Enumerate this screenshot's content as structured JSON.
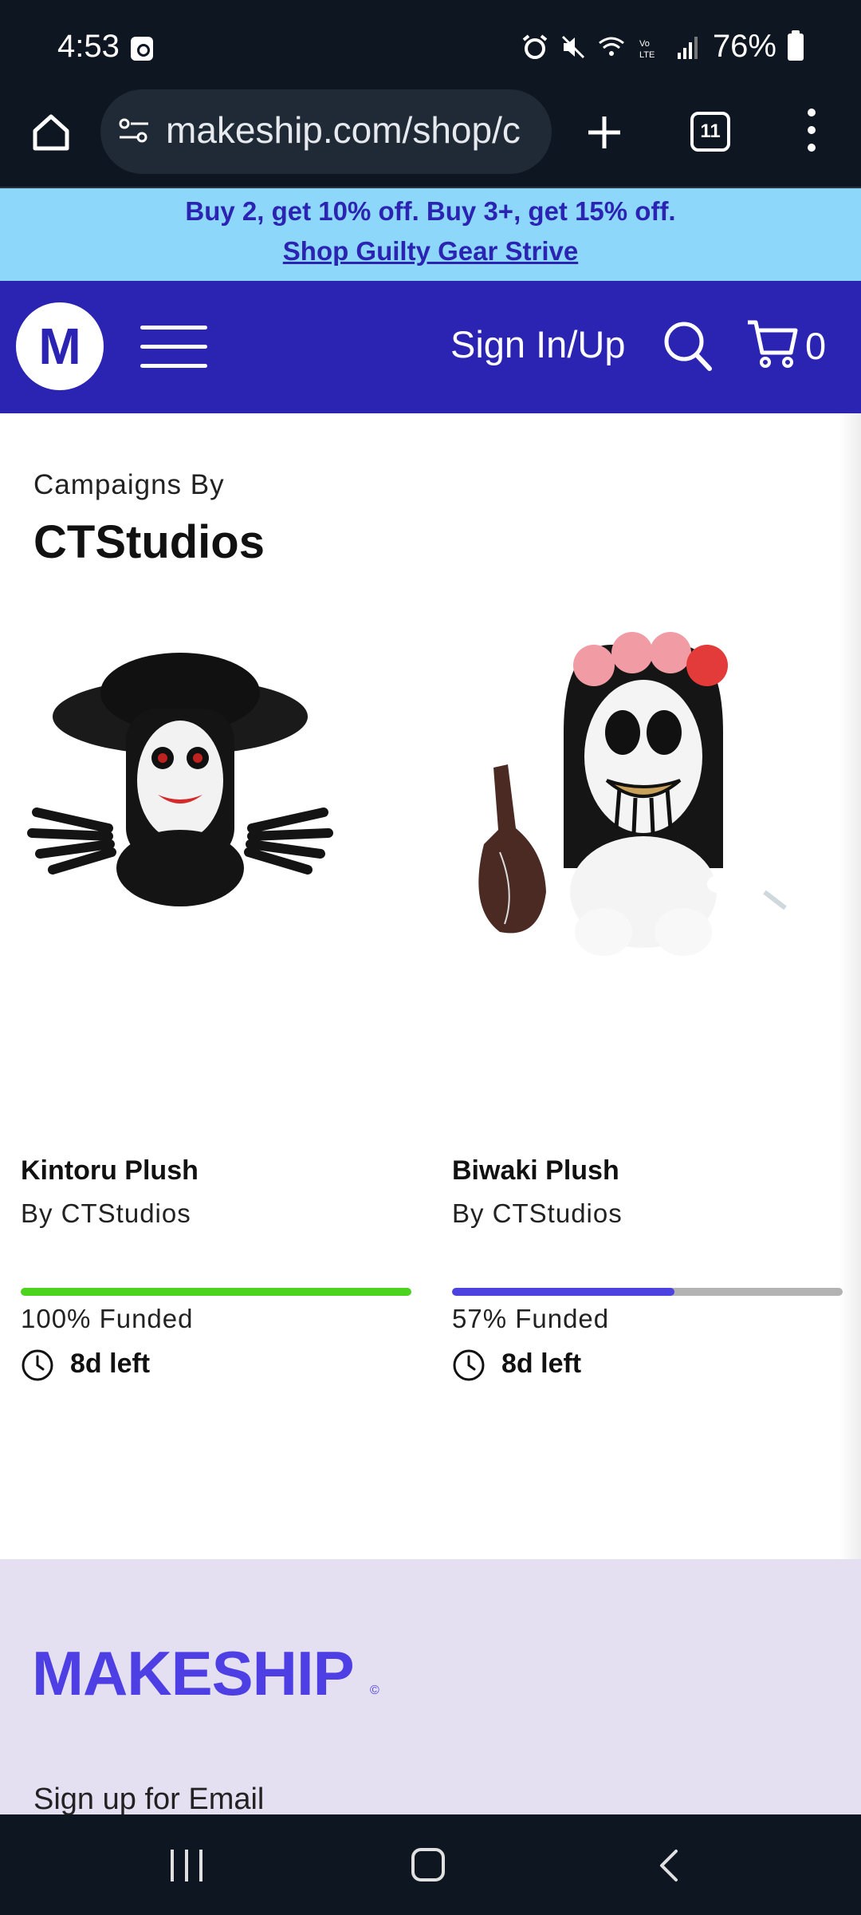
{
  "status": {
    "time": "4:53",
    "battery": "76%"
  },
  "browser": {
    "url": "makeship.com/shop/c",
    "tab_count": "11"
  },
  "promo": {
    "text": "Buy 2, get 10% off. Buy 3+, get 15% off.",
    "link": "Shop Guilty Gear Strive"
  },
  "header": {
    "logo": "M",
    "signin": "Sign In/Up",
    "cart_count": "0"
  },
  "page": {
    "label": "Campaigns By",
    "title": "CTStudios"
  },
  "products": [
    {
      "title": "Kintoru Plush",
      "by": "By CTStudios",
      "funded": "100% Funded",
      "funded_fraction": 1.0,
      "bar_color": "#4bd31e",
      "time_left": "8d left"
    },
    {
      "title": "Biwaki Plush",
      "by": "By CTStudios",
      "funded": "57% Funded",
      "funded_fraction": 0.57,
      "bar_color": "#4b42e0",
      "time_left": "8d left"
    }
  ],
  "footer": {
    "logo": "MAKESHIP",
    "copyright": "©",
    "signup": "Sign up for Email"
  },
  "icons": [
    "home-icon",
    "tune-icon",
    "plus-icon",
    "tabs-icon",
    "more-vert-icon",
    "hamburger-icon",
    "search-icon",
    "cart-icon",
    "clock-icon"
  ]
}
